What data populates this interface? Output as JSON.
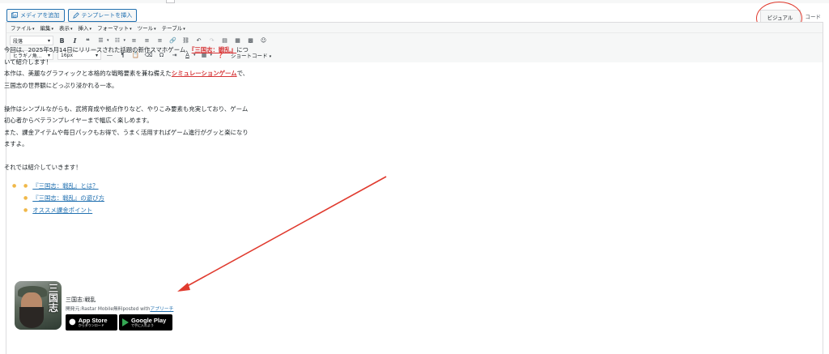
{
  "media_buttons": {
    "add_media": "メディアを追加",
    "insert_template": "テンプレートを挿入"
  },
  "mode_tabs": {
    "visual": "ビジュアル",
    "code": "コード"
  },
  "menubar": [
    "ファイル",
    "編集",
    "表示",
    "挿入",
    "フォーマット",
    "ツール",
    "テーブル"
  ],
  "toolbar": {
    "format_select": "段落",
    "font_select": "ヒラギノ角...",
    "size_select": "16px",
    "shortcode": "ショートコード"
  },
  "content": {
    "p1_before": "今回は、2025年5月14日にリリースされた話題の新作スマホゲーム、",
    "p1_link": "『三国志：戦乱』",
    "p1_after_a": "につ",
    "p1_after_b": "いて紹介します！",
    "p2_before": "本作は、美麗なグラフィックと本格的な戦略要素を兼ね備えた",
    "p2_link": "シミュレーションゲーム",
    "p2_after": "で、",
    "p3": "三国志の世界観にどっぷり浸かれる一本。",
    "p4": "操作はシンプルながらも、武将育成や拠点作りなど、やりこみ要素も充実しており、ゲーム",
    "p5": "初心者からベテランプレイヤーまで幅広く楽しめます。",
    "p6": "また、課金アイテムや毎日パックもお得で、うまく活用すればゲーム進行がグッと楽になり",
    "p7": "ますよ。",
    "p8": "それでは紹介していきます！",
    "toc": [
      "『三国志：戦乱』とは？",
      "『三国志：戦乱』の遊び方",
      "オススメ課金ポイント"
    ]
  },
  "app_card": {
    "name": "三国志:戦乱",
    "dev_prefix": "開発元:Rastar Mobile無料posted with",
    "dev_link": "アプリーチ",
    "icon_text": "三国志",
    "app_store_small": "Download on the",
    "app_store_big": "App Store",
    "app_store_sub": "からダウンロード",
    "google_play_big": "Google Play",
    "google_play_sub": "で手に入れよう"
  },
  "colors": {
    "annotation": "#e03a2e",
    "link": "#2271b1",
    "highlight": "#d63638"
  }
}
